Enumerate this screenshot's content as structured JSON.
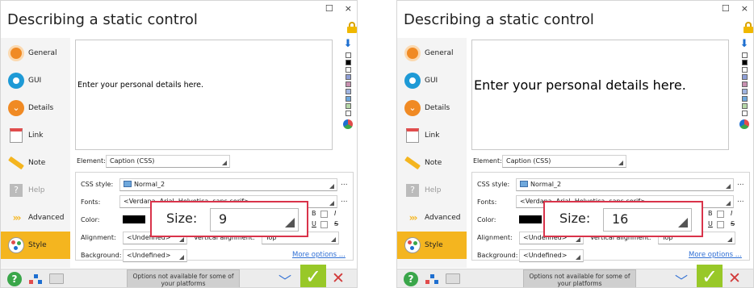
{
  "panels": [
    {
      "title": "Describing a static control",
      "window_buttons": {
        "maximize": "☐",
        "close": "×"
      },
      "sidebar": [
        {
          "label": "General",
          "icon": "general-icon",
          "state": "normal"
        },
        {
          "label": "GUI",
          "icon": "gui-icon",
          "state": "normal"
        },
        {
          "label": "Details",
          "icon": "details-icon",
          "state": "normal"
        },
        {
          "label": "Link",
          "icon": "link-icon",
          "state": "normal"
        },
        {
          "label": "Note",
          "icon": "note-icon",
          "state": "normal"
        },
        {
          "label": "Help",
          "icon": "help-icon",
          "state": "disabled"
        },
        {
          "label": "Advanced",
          "icon": "advanced-icon",
          "state": "normal"
        },
        {
          "label": "Style",
          "icon": "style-icon",
          "state": "active"
        }
      ],
      "preview_text": "Enter your personal details here.",
      "element_label": "Element:",
      "element_value": "Caption (CSS)",
      "css_style_label": "CSS style:",
      "css_style_value": "Normal_2",
      "fonts_label": "Fonts:",
      "fonts_value": "<Verdana, Arial, Helvetica, sans-serif>",
      "color_label": "Color:",
      "color_value": "#000000",
      "alignment_label": "Alignment:",
      "alignment_value": "<Undefined>",
      "vertical_alignment_label": "Vertical alignment:",
      "vertical_alignment_value": "Top",
      "background_label": "Background:",
      "background_value": "<Undefined>",
      "more_options": "More options ...",
      "bold_label": "B",
      "italic_label": "I",
      "underline_label": "U",
      "strike_label": "S",
      "size_label": "Size:",
      "size_value": "9",
      "notice": "Options not available for some of your platforms",
      "ellipsis": "..."
    },
    {
      "title": "Describing a static control",
      "window_buttons": {
        "maximize": "☐",
        "close": "×"
      },
      "sidebar": [
        {
          "label": "General",
          "icon": "general-icon",
          "state": "normal"
        },
        {
          "label": "GUI",
          "icon": "gui-icon",
          "state": "normal"
        },
        {
          "label": "Details",
          "icon": "details-icon",
          "state": "normal"
        },
        {
          "label": "Link",
          "icon": "link-icon",
          "state": "normal"
        },
        {
          "label": "Note",
          "icon": "note-icon",
          "state": "normal"
        },
        {
          "label": "Help",
          "icon": "help-icon",
          "state": "disabled"
        },
        {
          "label": "Advanced",
          "icon": "advanced-icon",
          "state": "normal"
        },
        {
          "label": "Style",
          "icon": "style-icon",
          "state": "active"
        }
      ],
      "preview_text": "Enter your personal details here.",
      "element_label": "Element:",
      "element_value": "Caption (CSS)",
      "css_style_label": "CSS style:",
      "css_style_value": "Normal_2",
      "fonts_label": "Fonts:",
      "fonts_value": "<Verdana, Arial, Helvetica, sans-serif>",
      "color_label": "Color:",
      "color_value": "#000000",
      "alignment_label": "Alignment:",
      "alignment_value": "<Undefined>",
      "vertical_alignment_label": "Vertical alignment:",
      "vertical_alignment_value": "Top",
      "background_label": "Background:",
      "background_value": "<Undefined>",
      "more_options": "More options ...",
      "bold_label": "B",
      "italic_label": "I",
      "underline_label": "U",
      "strike_label": "S",
      "size_label": "Size:",
      "size_value": "16",
      "notice": "Options not available for some of your platforms",
      "ellipsis": "..."
    }
  ],
  "colors": {
    "accent": "#f4b51f",
    "highlight_border": "#d9334a",
    "ok_green": "#98c828",
    "link_blue": "#2e6ed4",
    "swatch_colors": [
      "#ffffff",
      "#000000",
      "#6f89c4",
      "#a0b4e0",
      "#c890b0",
      "#a0b4e0",
      "#6fa8dc",
      "#b6d7a8",
      "#3aa64a"
    ]
  }
}
